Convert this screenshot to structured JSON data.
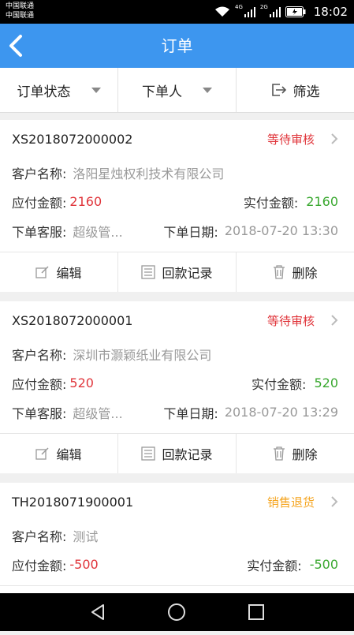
{
  "status_bar": {
    "carrier1": "中国联通",
    "carrier2": "中国联通",
    "net1": "4G",
    "net2": "2G",
    "time": "18:02"
  },
  "header": {
    "title": "订单",
    "back_icon": "chevron-left-icon"
  },
  "filters": [
    {
      "label": "订单状态",
      "icon": "caret-down-icon"
    },
    {
      "label": "下单人",
      "icon": "caret-down-icon"
    },
    {
      "label": "筛选",
      "icon": "filter-export-icon"
    }
  ],
  "labels": {
    "customer": "客户名称:",
    "payable": "应付金额:",
    "paid": "实付金额:",
    "service": "下单客服:",
    "date": "下单日期:"
  },
  "actions": {
    "edit": "编辑",
    "payment_record": "回款记录",
    "delete": "删除"
  },
  "colors": {
    "accent": "#3d96ef",
    "status_pending": "#e0353b",
    "status_return": "#f5a623",
    "amount_red": "#e0353b",
    "amount_green": "#39a82f"
  },
  "orders": [
    {
      "no": "XS2018072000002",
      "status": "等待审核",
      "customer": "洛阳星烛权利技术有限公司",
      "payable": "2160",
      "paid": "2160",
      "service": "超级管...",
      "date": "2018-07-20 13:30"
    },
    {
      "no": "XS2018072000001",
      "status": "等待审核",
      "customer": "深圳市灏颖纸业有限公司",
      "payable": "520",
      "paid": "520",
      "service": "超级管...",
      "date": "2018-07-20 13:29"
    },
    {
      "no": "TH2018071900001",
      "status": "销售退货",
      "customer": "测试",
      "payable": "-500",
      "paid": "-500"
    }
  ]
}
